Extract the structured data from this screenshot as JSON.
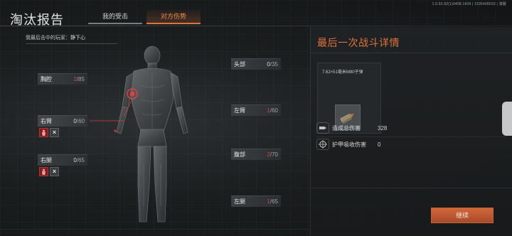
{
  "version_text": "1.0.93.92(1)0408.1609 | 1535408033 | 澳服",
  "title": "淘汰报告",
  "tabs": [
    {
      "label": "我的受击",
      "active": false
    },
    {
      "label": "对方伤势",
      "active": true
    }
  ],
  "killer_info": {
    "meta": "",
    "prefix": "我最后击中的玩家：",
    "name": "静下心"
  },
  "body_parts": [
    {
      "id": "chest",
      "label": "胸腔",
      "cur": "2",
      "max": "85",
      "hurt": true
    },
    {
      "id": "right-arm",
      "label": "右臂",
      "cur": "0",
      "max": "60",
      "hurt": false
    },
    {
      "id": "right-leg",
      "label": "右腿",
      "cur": "0",
      "max": "65",
      "hurt": false
    },
    {
      "id": "head",
      "label": "头部",
      "cur": "0",
      "max": "35",
      "hurt": false
    },
    {
      "id": "left-arm",
      "label": "左臂",
      "cur": "1",
      "max": "60",
      "hurt": true
    },
    {
      "id": "stomach",
      "label": "腹部",
      "cur": "2",
      "max": "70",
      "hurt": true
    },
    {
      "id": "left-leg",
      "label": "左腿",
      "cur": "1",
      "max": "65",
      "hurt": true
    }
  ],
  "hp_separator": "/",
  "right_panel": {
    "title": "最后一次战斗详情",
    "weapon_name": "7.62×51毫米M80子弹",
    "stats": [
      {
        "icon": "bullet-icon",
        "label": "造成总伤害",
        "value": "328"
      },
      {
        "icon": "crosshair-icon",
        "label": "护甲吸收伤害",
        "value": "0"
      }
    ],
    "continue_label": "继续"
  },
  "colors": {
    "accent": "#e0733a",
    "hurt": "#d8434b",
    "button": "#b8532f"
  }
}
